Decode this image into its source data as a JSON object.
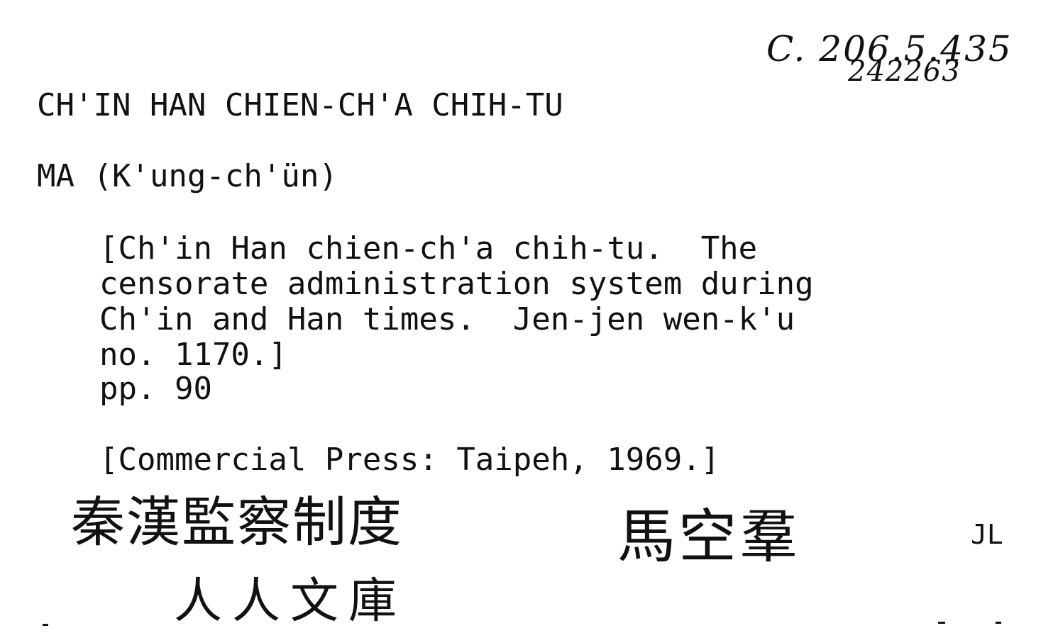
{
  "card": {
    "call_number": "C. 206.5.435",
    "accession_number": "242263",
    "heading_title": "CH'IN HAN CHIEN-CH'A CHIH-TU",
    "author_heading": "MA (K'ung-ch'ün)",
    "description_lines": [
      "[Ch'in Han chien-ch'a chih-tu.  The",
      "censorate administration system during",
      "Ch'in and Han times.  Jen-jen wen-k'u",
      "no. 1170.]",
      "pp. 90"
    ],
    "imprint": "[Commercial Press: Taipeh, 1969.]",
    "handwritten_title_chinese": "秦漢監察制度",
    "handwritten_series_chinese": "人人文庫",
    "handwritten_author_chinese": "馬空羣",
    "cataloger_initials": "JL"
  }
}
